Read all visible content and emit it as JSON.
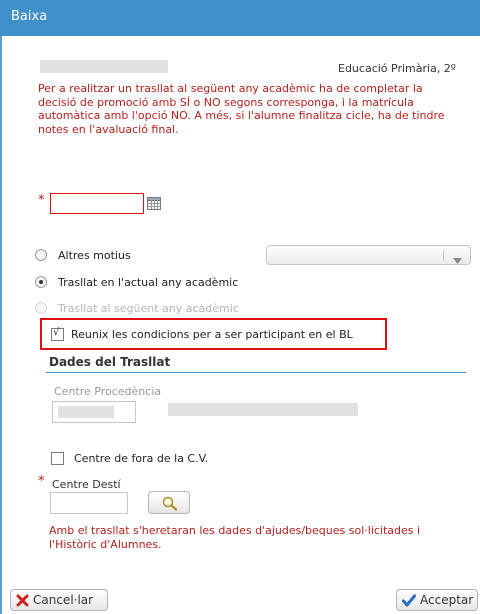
{
  "window": {
    "title": "Baixa"
  },
  "header": {
    "student_name": "",
    "course": "Educació Primària, 2º"
  },
  "warning": {
    "text": "Per a realitzar un trasllat al següent any acadèmic ha de completar la decisió de promoció amb SÍ o NO segons corresponga, i la matrícula automàtica amb l'opció NO. A més, si l'alumne finalitza cicle, ha de tindre notes en l'avaluació final."
  },
  "date_field": {
    "required_marker": "*",
    "value": ""
  },
  "options": {
    "other_reasons": {
      "label": "Altres motius",
      "selected": false
    },
    "reasons_select": {
      "value": ""
    },
    "transfer_current": {
      "label": "Trasllat en l'actual any acadèmic",
      "selected": true
    },
    "transfer_next": {
      "label": "Trasllat al següent any acadèmic",
      "selected": false,
      "disabled": true
    }
  },
  "bl_checkbox": {
    "label": "Reunix les condicions per a ser participant en el BL",
    "checked": true,
    "check_mark": "√",
    "highlight_color": "#e01010"
  },
  "transfer_section": {
    "title": "Dades del Trasllat",
    "origin_label": "Centre Procedència",
    "origin_code": "",
    "origin_name": "",
    "outside_cv_label": "Centre de fora de la C.V.",
    "outside_cv_checked": false,
    "dest_required_marker": "*",
    "dest_label": "Centre Destí",
    "dest_value": "",
    "note": "Amb el trasllat s'heretaran les dades d'ajudes/beques sol·licitades i l'Històric d'Alumnes."
  },
  "footer": {
    "cancel_label": "Cancel·lar",
    "accept_label": "Acceptar"
  },
  "colors": {
    "titlebar": "#3f8fc8",
    "warning_text": "#b3211c",
    "section_underline": "#3f8fc8",
    "error_border": "#e01010"
  }
}
